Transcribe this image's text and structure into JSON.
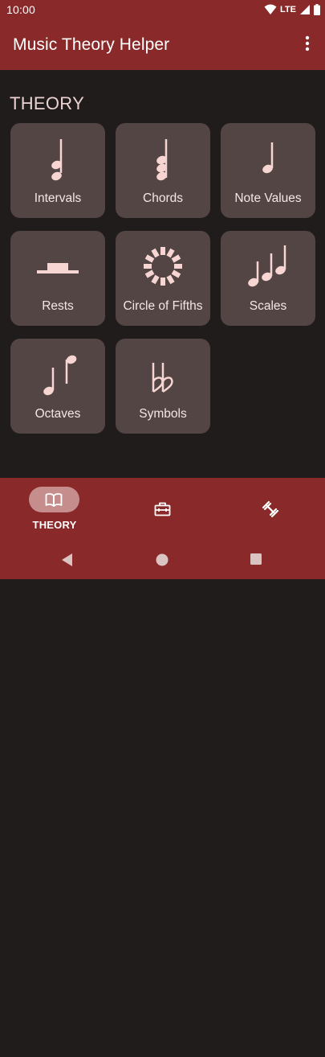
{
  "status_bar": {
    "time": "10:00",
    "network": "LTE"
  },
  "app_bar": {
    "title": "Music Theory Helper",
    "menu_icon": "more-vert-icon"
  },
  "section": {
    "title": "THEORY"
  },
  "cards": [
    {
      "label": "Intervals",
      "icon": "intervals-icon"
    },
    {
      "label": "Chords",
      "icon": "chord-icon"
    },
    {
      "label": "Note Values",
      "icon": "quarter-note-icon"
    },
    {
      "label": "Rests",
      "icon": "rest-icon"
    },
    {
      "label": "Circle of Fifths",
      "icon": "circle-of-fifths-icon"
    },
    {
      "label": "Scales",
      "icon": "scales-icon"
    },
    {
      "label": "Octaves",
      "icon": "octaves-icon"
    },
    {
      "label": "Symbols",
      "icon": "double-flat-icon"
    }
  ],
  "bottom_nav": {
    "items": [
      {
        "label": "THEORY",
        "icon": "book-icon",
        "selected": true
      },
      {
        "label": "",
        "icon": "toolbox-icon",
        "selected": false
      },
      {
        "label": "",
        "icon": "fitness-icon",
        "selected": false
      }
    ]
  },
  "system_nav": [
    "back-icon",
    "home-icon",
    "recents-icon"
  ],
  "colors": {
    "primary": "#8a2929",
    "background": "#201c1c",
    "card": "#524544",
    "accent": "#f6d5d2",
    "pill": "#c58e8c"
  }
}
